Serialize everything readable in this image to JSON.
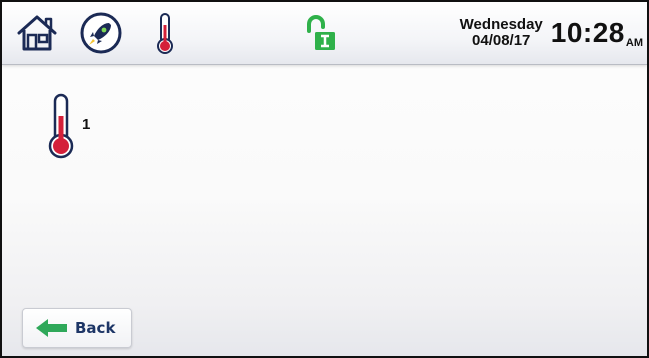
{
  "header": {
    "weekday": "Wednesday",
    "date": "04/08/17",
    "time": "10:28",
    "ampm": "AM",
    "icons": [
      "home-icon",
      "rocket-icon",
      "thermometer-icon",
      "unlock-icon"
    ],
    "lock_color": "#2fb14a",
    "thermometer_color": "#d4203a"
  },
  "main": {
    "sensor": {
      "icon": "thermometer-icon",
      "label": "1"
    }
  },
  "footer": {
    "back_label": "Back",
    "back_icon": "arrow-left-icon",
    "back_arrow_color": "#2fa85a"
  }
}
